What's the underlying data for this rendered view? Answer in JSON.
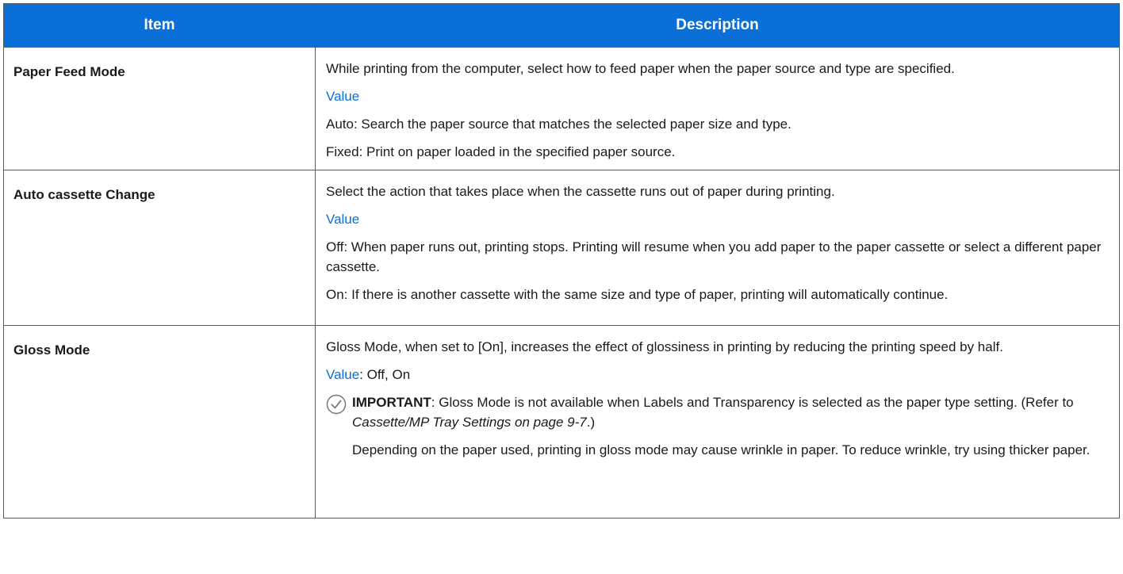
{
  "header": {
    "item": "Item",
    "description": "Description"
  },
  "rows": [
    {
      "item": "Paper Feed Mode",
      "intro": "While printing from the computer, select how to feed paper when the paper source and type are specified.",
      "value_label": "Value",
      "lines": [
        "Auto: Search the paper source that matches the selected paper size and type.",
        "Fixed: Print on paper loaded in the specified paper source."
      ]
    },
    {
      "item": "Auto cassette Change",
      "intro": "Select the action that takes place when the cassette runs out of paper during printing.",
      "value_label": "Value",
      "lines": [
        "Off: When paper runs out, printing stops. Printing will resume when you add paper to the paper cassette or select a different paper cassette.",
        "On: If there is another cassette with the same size and type of paper, printing will automatically continue."
      ]
    },
    {
      "item": "Gloss Mode",
      "intro": "Gloss Mode, when set to [On], increases the effect of glossiness in printing by reducing the printing speed by half.",
      "value_label": "Value",
      "value_suffix": ": Off, On",
      "important": {
        "label": "IMPORTANT",
        "text_before": ": Gloss Mode is not available when Labels and Transparency is selected as the paper type setting. (Refer to ",
        "ref": "Cassette/MP Tray Settings on page 9-7",
        "text_after": ".)"
      },
      "note": "Depending on the paper used, printing in gloss mode may cause wrinkle in paper. To reduce wrinkle, try using thicker paper."
    }
  ],
  "colors": {
    "header_bg": "#0a6fd6",
    "value_label": "#0a6fd6",
    "border": "#5a5a5a"
  },
  "icons": {
    "important": "check-circle-icon"
  }
}
